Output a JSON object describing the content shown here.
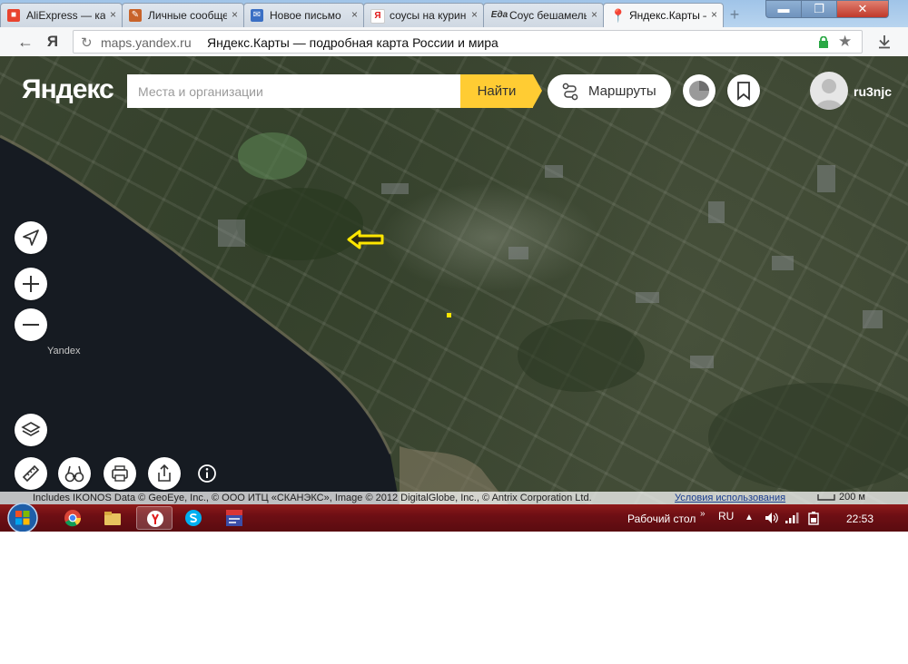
{
  "browser": {
    "tabs": [
      {
        "title": "AliExpress — ка",
        "favicon": "aliexpress-icon",
        "color": "#e8432e"
      },
      {
        "title": "Личные сообще",
        "favicon": "forum-icon",
        "color": "#c8632a"
      },
      {
        "title": "Новое письмо",
        "favicon": "mail-icon",
        "color": "#3a6fc4"
      },
      {
        "title": "соусы на курин",
        "favicon": "yandex-search-icon",
        "color": "#e0191a"
      },
      {
        "title": "Соус бешамель",
        "favicon": "eda-icon",
        "color": "#333333"
      },
      {
        "title": "Яндекс.Карты –",
        "favicon": "map-pin-icon",
        "color": "#e0191a",
        "active": true
      }
    ],
    "close_glyph": "×",
    "newtab_glyph": "+",
    "window_controls": {
      "minimize": "▬",
      "maximize": "❐",
      "close": "✕"
    },
    "address": {
      "url": "maps.yandex.ru",
      "page_title": "Яндекс.Карты — подробная карта России и мира",
      "browser_logo": "Я"
    }
  },
  "map": {
    "logo": "Яндекс",
    "search_placeholder": "Места и организации",
    "find_label": "Найти",
    "routes_label": "Маршруты",
    "user_name": "ru3njc",
    "watermark": "Yandex",
    "attribution": "Includes IKONOS Data © GeoEye, Inc., © ООО ИТЦ «СКАНЭКС», Image © 2012 DigitalGlobe, Inc., © Antrix Corporation Ltd.",
    "terms_link": "Условия использования",
    "scale_label": "200 м",
    "colors": {
      "accent": "#ffcc33",
      "marker": "#ffe600"
    }
  },
  "taskbar": {
    "apps": [
      "chrome-icon",
      "explorer-icon",
      "yandex-browser-icon",
      "skype-icon",
      "app-icon"
    ],
    "desktop_label": "Рабочий стол",
    "language": "RU",
    "time": "22:53"
  }
}
